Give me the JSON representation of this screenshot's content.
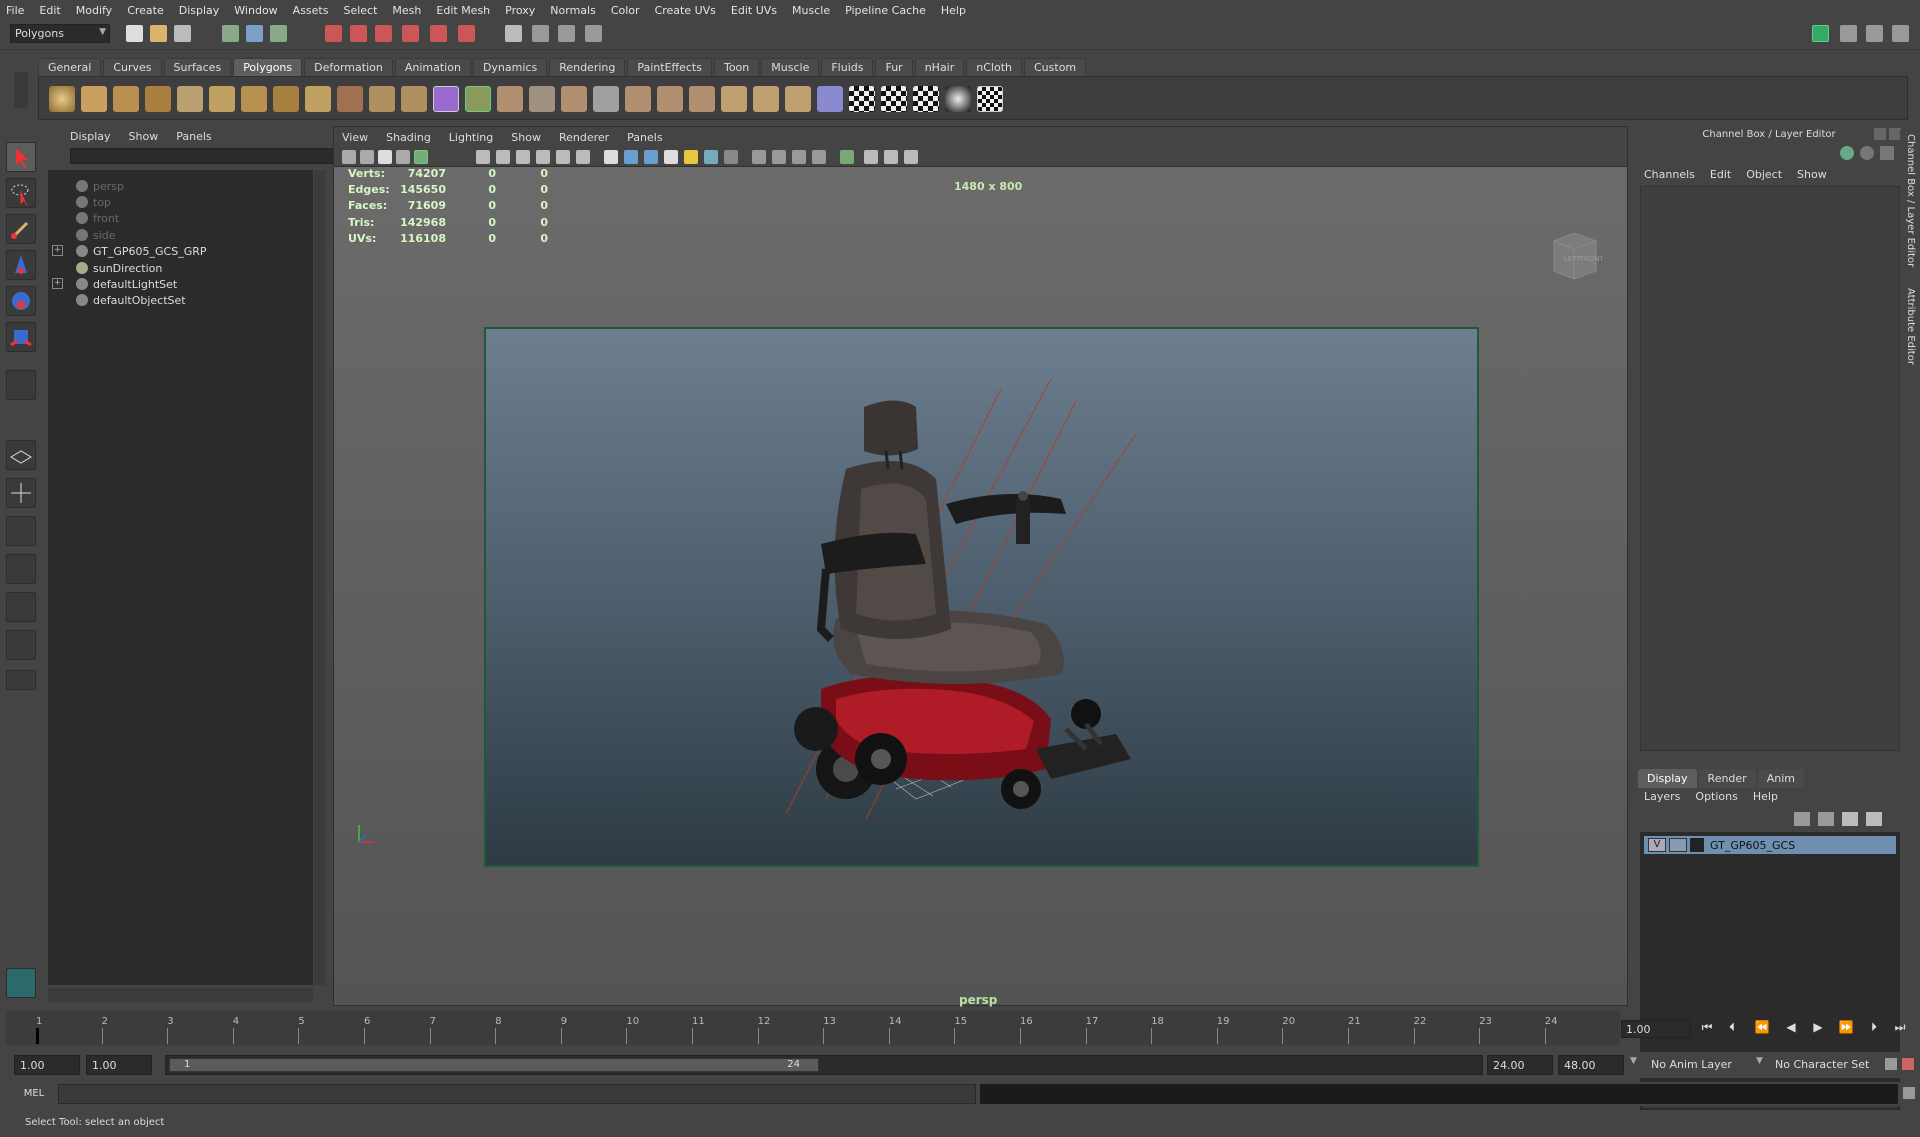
{
  "menubar": [
    "File",
    "Edit",
    "Modify",
    "Create",
    "Display",
    "Window",
    "Assets",
    "Select",
    "Mesh",
    "Edit Mesh",
    "Proxy",
    "Normals",
    "Color",
    "Create UVs",
    "Edit UVs",
    "Muscle",
    "Pipeline Cache",
    "Help"
  ],
  "statusline": {
    "mode": "Polygons"
  },
  "shelf": {
    "tabs": [
      "General",
      "Curves",
      "Surfaces",
      "Polygons",
      "Deformation",
      "Animation",
      "Dynamics",
      "Rendering",
      "PaintEffects",
      "Toon",
      "Muscle",
      "Fluids",
      "Fur",
      "nHair",
      "nCloth",
      "Custom"
    ],
    "active": "Polygons"
  },
  "outliner": {
    "menu": [
      "Display",
      "Show",
      "Panels"
    ],
    "items": [
      {
        "label": "persp",
        "dim": true
      },
      {
        "label": "top",
        "dim": true
      },
      {
        "label": "front",
        "dim": true
      },
      {
        "label": "side",
        "dim": true
      },
      {
        "label": "GT_GP605_GCS_GRP",
        "dim": false,
        "expand": true
      },
      {
        "label": "sunDirection",
        "dim": false
      },
      {
        "label": "defaultLightSet",
        "dim": false,
        "expand": true
      },
      {
        "label": "defaultObjectSet",
        "dim": false
      }
    ]
  },
  "viewport": {
    "menu": [
      "View",
      "Shading",
      "Lighting",
      "Show",
      "Renderer",
      "Panels"
    ],
    "resolution": "1480 x 800",
    "camera": "persp",
    "hud": [
      {
        "label": "Verts:",
        "v1": "74207",
        "v2": "0",
        "v3": "0"
      },
      {
        "label": "Edges:",
        "v1": "145650",
        "v2": "0",
        "v3": "0"
      },
      {
        "label": "Faces:",
        "v1": "71609",
        "v2": "0",
        "v3": "0"
      },
      {
        "label": "Tris:",
        "v1": "142968",
        "v2": "0",
        "v3": "0"
      },
      {
        "label": "UVs:",
        "v1": "116108",
        "v2": "0",
        "v3": "0"
      }
    ],
    "viewcube": {
      "left": "LEFT",
      "front": "FRONT"
    }
  },
  "channelbox": {
    "title": "Channel Box / Layer Editor",
    "menu": [
      "Channels",
      "Edit",
      "Object",
      "Show"
    ],
    "side_tabs": [
      "Channel Box / Layer Editor",
      "Attribute Editor"
    ]
  },
  "layers": {
    "tabs": [
      "Display",
      "Render",
      "Anim"
    ],
    "active": "Display",
    "menu": [
      "Layers",
      "Options",
      "Help"
    ],
    "row": {
      "visible": "V",
      "name": "GT_GP605_GCS"
    }
  },
  "timeline": {
    "ticks": [
      "1",
      "2",
      "3",
      "4",
      "5",
      "6",
      "7",
      "8",
      "9",
      "10",
      "11",
      "12",
      "13",
      "14",
      "15",
      "16",
      "17",
      "18",
      "19",
      "20",
      "21",
      "22",
      "23",
      "24"
    ],
    "current_frame": "1.00"
  },
  "range": {
    "start": "1.00",
    "playback_start": "1.00",
    "slider_start": "1",
    "slider_end": "24",
    "playback_end": "24.00",
    "end": "48.00",
    "anim_layer": "No Anim Layer",
    "character_set": "No Character Set"
  },
  "cmdline": {
    "mel": "MEL"
  },
  "helpline": {
    "text": "Select Tool: select an object"
  }
}
